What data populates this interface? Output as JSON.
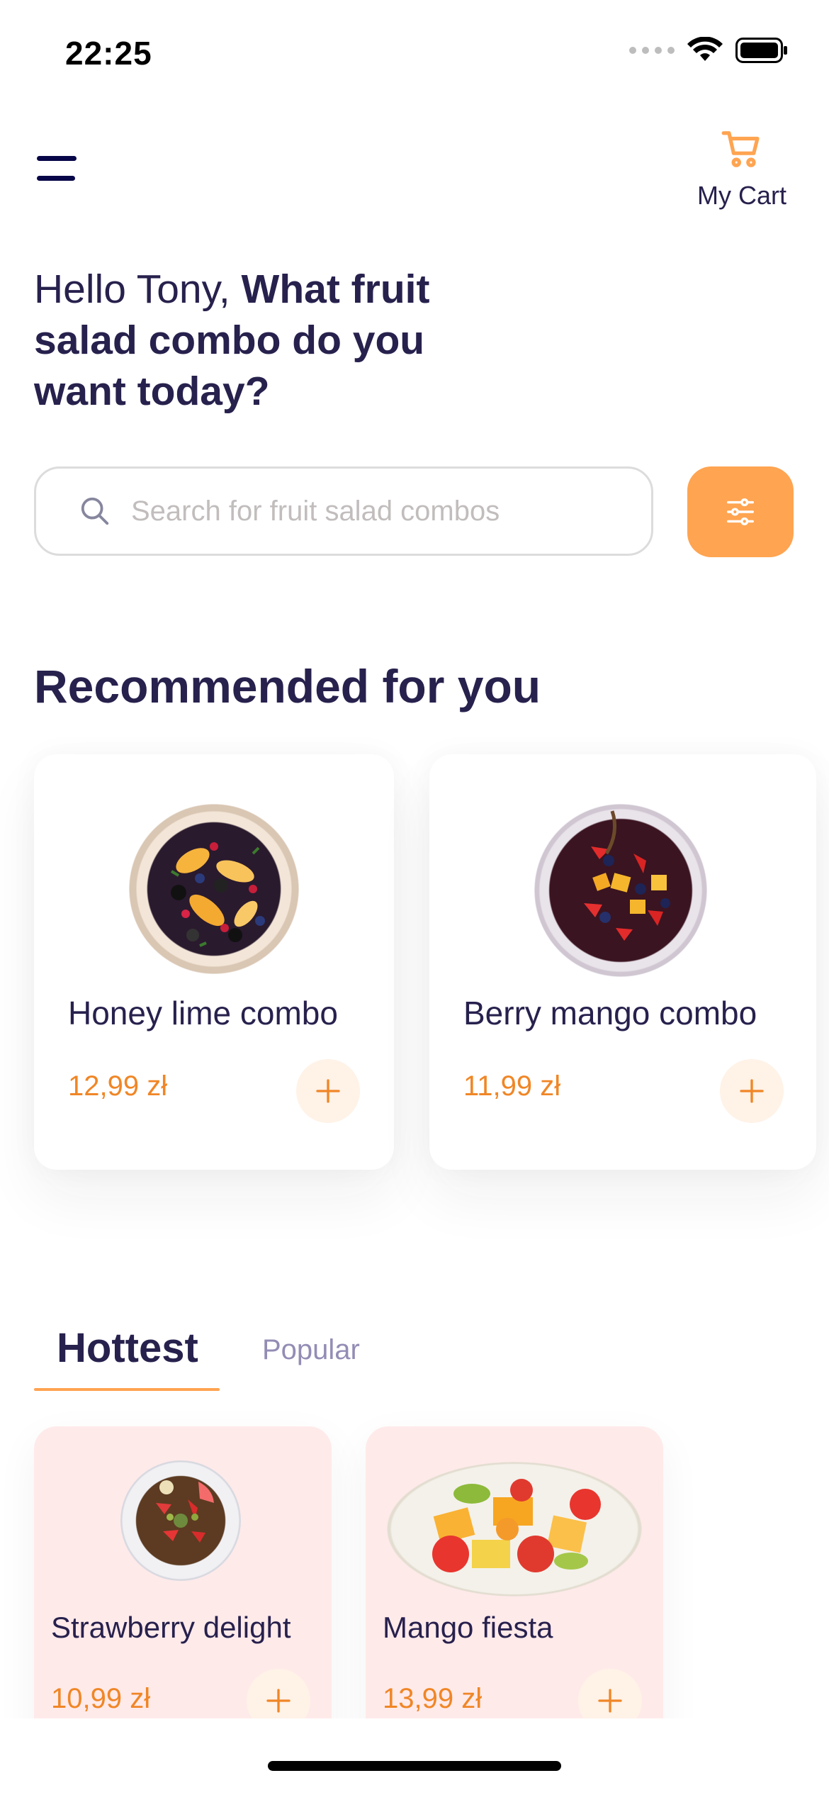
{
  "status_bar": {
    "time": "22:25"
  },
  "header": {
    "cart_label": "My Cart"
  },
  "greeting": {
    "hello": "Hello Tony, ",
    "question": "What fruit salad combo do you want today?"
  },
  "search": {
    "placeholder": "Search for fruit salad combos"
  },
  "recommended": {
    "title": "Recommended for you",
    "items": [
      {
        "name": "Honey lime combo",
        "price": "12,99 zł"
      },
      {
        "name": "Berry mango combo",
        "price": "11,99 zł"
      }
    ]
  },
  "tabs": {
    "hottest": "Hottest",
    "popular": "Popular"
  },
  "hottest": {
    "items": [
      {
        "name": "Strawberry delight",
        "price": "10,99 zł"
      },
      {
        "name": "Mango fiesta",
        "price": "13,99 zł"
      }
    ]
  },
  "colors": {
    "accent": "#FFA451",
    "price": "#F08626",
    "text": "#27214D",
    "hot_card_bg": "#FFEAEA"
  }
}
